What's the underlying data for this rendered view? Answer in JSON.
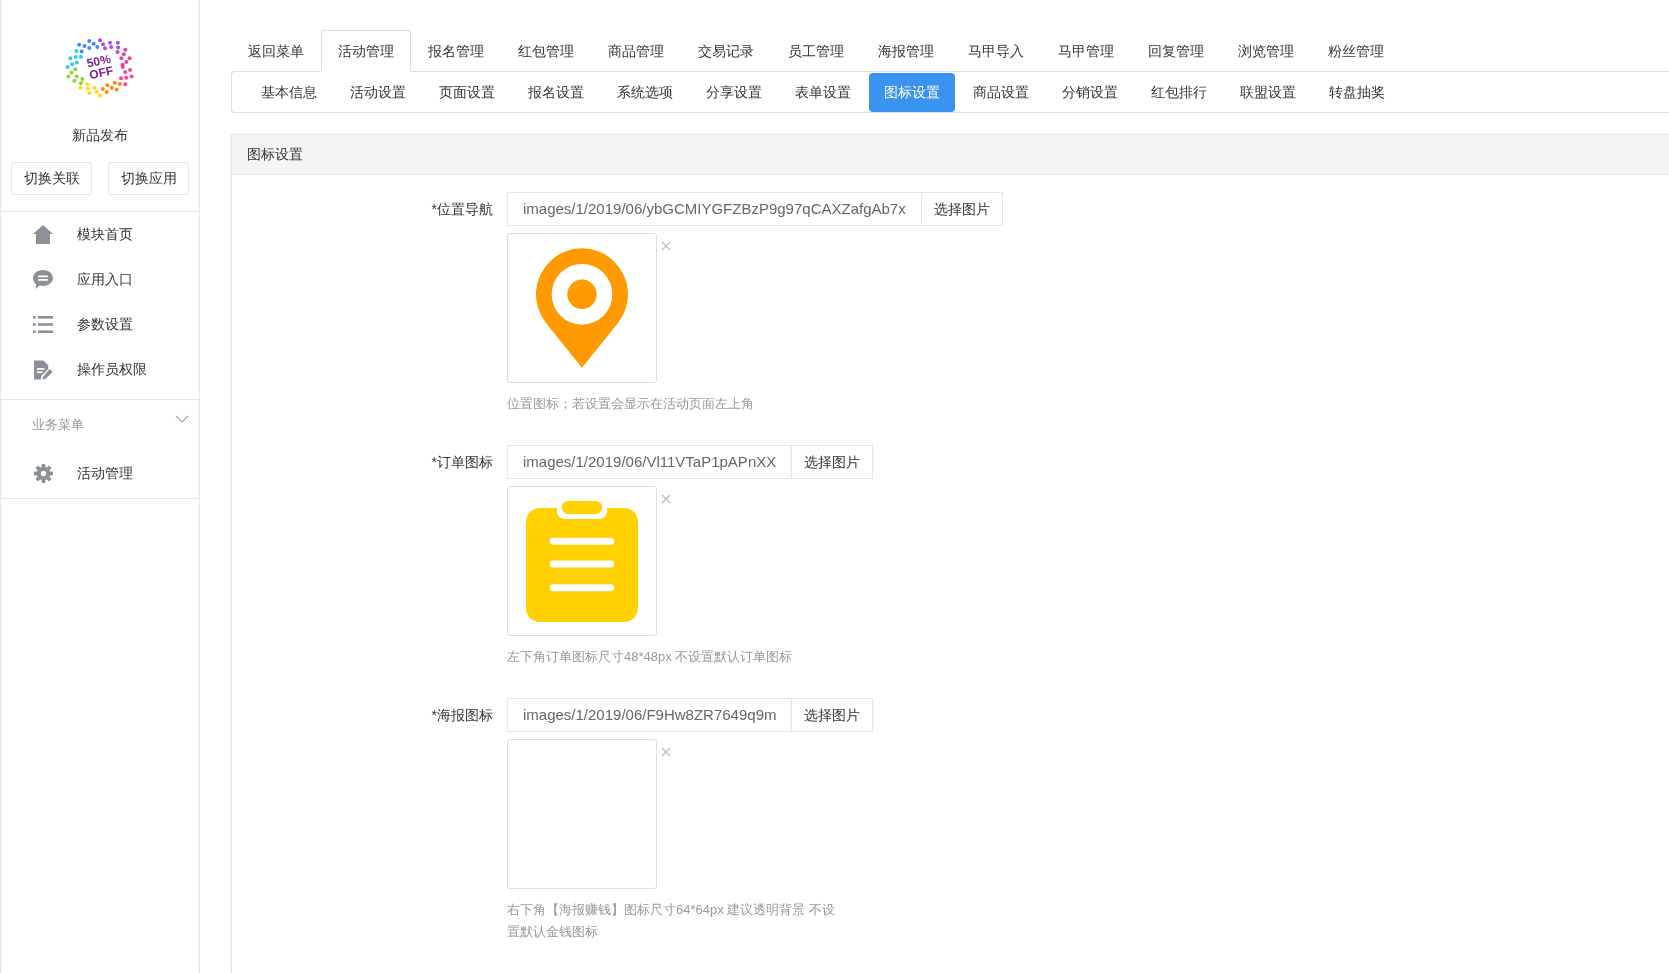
{
  "sidebar": {
    "logo_text": "50% OFF",
    "title": "新品发布",
    "buttons": [
      "切换关联",
      "切换应用"
    ],
    "menu": [
      "模块首页",
      "应用入口",
      "参数设置",
      "操作员权限"
    ],
    "section": {
      "label": "业务菜单",
      "expanded": true,
      "items": [
        "活动管理"
      ]
    }
  },
  "top_tabs": [
    {
      "label": "返回菜单",
      "selected": false
    },
    {
      "label": "活动管理",
      "selected": true
    },
    {
      "label": "报名管理",
      "selected": false
    },
    {
      "label": "红包管理",
      "selected": false
    },
    {
      "label": "商品管理",
      "selected": false
    },
    {
      "label": "交易记录",
      "selected": false
    },
    {
      "label": "员工管理",
      "selected": false
    },
    {
      "label": "海报管理",
      "selected": false
    },
    {
      "label": "马甲导入",
      "selected": false
    },
    {
      "label": "马甲管理",
      "selected": false
    },
    {
      "label": "回复管理",
      "selected": false
    },
    {
      "label": "浏览管理",
      "selected": false
    },
    {
      "label": "粉丝管理",
      "selected": false
    }
  ],
  "sub_tabs": [
    {
      "label": "基本信息",
      "selected": false
    },
    {
      "label": "活动设置",
      "selected": false
    },
    {
      "label": "页面设置",
      "selected": false
    },
    {
      "label": "报名设置",
      "selected": false
    },
    {
      "label": "系统选项",
      "selected": false
    },
    {
      "label": "分享设置",
      "selected": false
    },
    {
      "label": "表单设置",
      "selected": false
    },
    {
      "label": "图标设置",
      "selected": true
    },
    {
      "label": "商品设置",
      "selected": false
    },
    {
      "label": "分销设置",
      "selected": false
    },
    {
      "label": "红包排行",
      "selected": false
    },
    {
      "label": "联盟设置",
      "selected": false
    },
    {
      "label": "转盘抽奖",
      "selected": false
    }
  ],
  "panel": {
    "title": "图标设置",
    "fields": [
      {
        "label": "*位置导航",
        "value": "images/1/2019/06/ybGCMIYGFZBzP9g97qCAXZafgAb7x",
        "button": "选择图片",
        "help": "位置图标；若设置会显示在活动页面左上角"
      },
      {
        "label": "*订单图标",
        "value": "images/1/2019/06/Vl11VTaP1pAPnXX",
        "button": "选择图片",
        "help": "左下角订单图标尺寸48*48px 不设置默认订单图标"
      },
      {
        "label": "*海报图标",
        "value": "images/1/2019/06/F9Hw8ZR7649q9m",
        "button": "选择图片",
        "help": "右下角【海报赚钱】图标尺寸64*64px 建议透明背景 不设置默认金钱图标"
      }
    ]
  }
}
